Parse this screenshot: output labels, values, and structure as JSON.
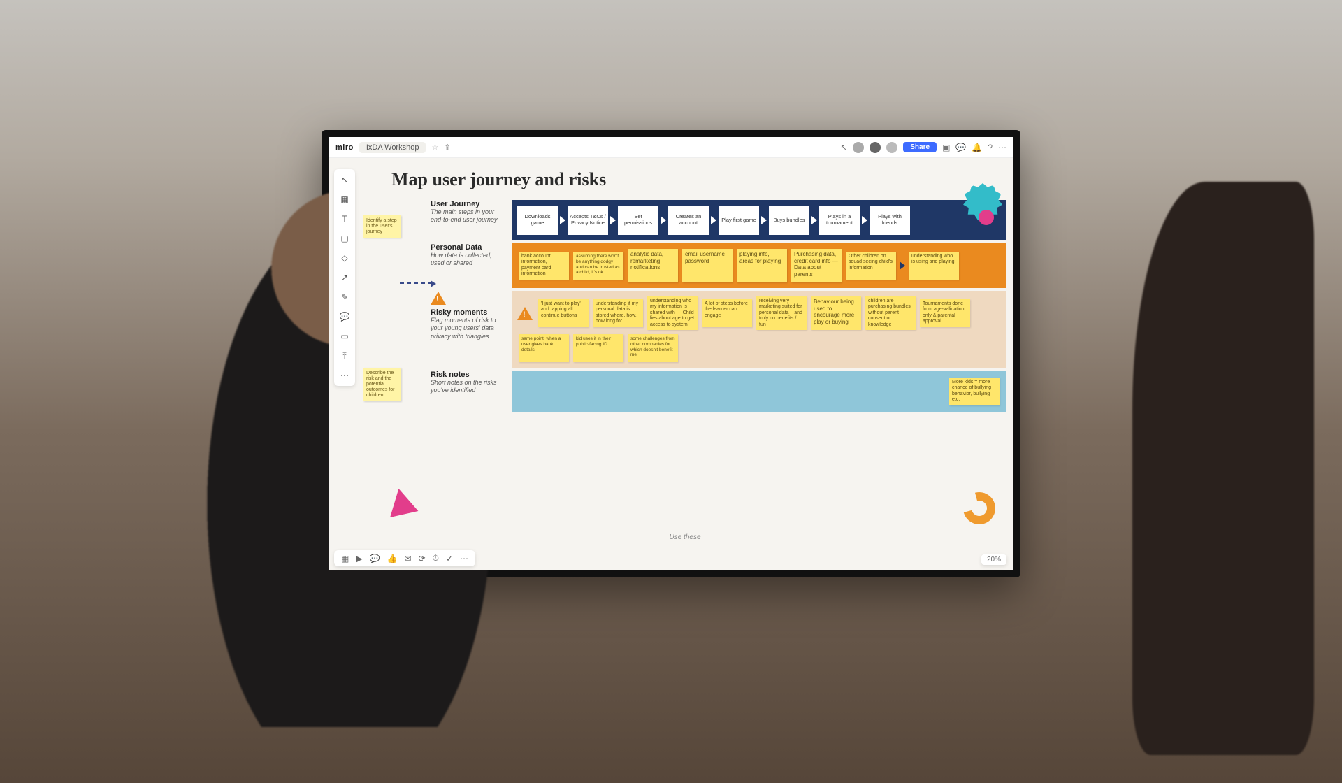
{
  "app": {
    "logo": "miro",
    "board_name": "IxDA Workshop"
  },
  "topbar": {
    "share_label": "Share",
    "zoom": "20%"
  },
  "side_notes": {
    "identify": "Identify a step in the user's journey",
    "describe": "Describe the risk and the potential outcomes for children"
  },
  "board_title": "Map user journey and risks",
  "rows": {
    "journey": {
      "title": "User Journey",
      "subtitle": "The main steps in your end-to-end user journey",
      "steps": [
        "Downloads game",
        "Accepts T&Cs / Privacy Notice",
        "Set permissions",
        "Creates an account",
        "Play first game",
        "Buys bundles",
        "Plays in a tournament",
        "Plays with friends"
      ]
    },
    "personal": {
      "title": "Personal Data",
      "subtitle": "How data is collected, used or shared",
      "stickies": [
        "bank account information, payment card information",
        "assuming there won't be anything dodgy and can be trusted as a child, it's ok",
        "analytic data, remarketing notifications",
        "email username password",
        "playing info, areas for playing",
        "Purchasing data, credit card info — Data about parents",
        "Other children on squad seeing child's information",
        "understanding who is using and playing"
      ]
    },
    "risky": {
      "title": "Risky moments",
      "subtitle": "Flag moments of risk to your young users' data privacy with triangles",
      "stickies": [
        "'I just want to play' and tapping all continue buttons",
        "understanding if my personal data is stored where, how, how long for",
        "understanding who my information is shared with — Child lies about age to get access to system",
        "A lot of steps before the learner can engage",
        "receiving very marketing suited for personal data – and truly no benefits / fun",
        "Behaviour being used to encourage more play or buying",
        "children are purchasing bundles without parent consent or knowledge",
        "Tournaments done from age-validation only & parental approval",
        "same point, when a user gives bank details",
        "kid uses it in their public-facing ID",
        "some challenges from other companies for which doesn't benefit me"
      ]
    },
    "notes": {
      "title": "Risk notes",
      "subtitle": "Short notes on the risks you've identified",
      "stickies": [
        "More kids = more chance of bullying behavior, bullying etc."
      ]
    }
  },
  "footer_hint": "Use these",
  "tools": [
    "cursor",
    "template",
    "text",
    "sticky",
    "shape",
    "connector",
    "pen",
    "comment",
    "frame",
    "upload",
    "apps"
  ],
  "bottom_tools": [
    "frames",
    "present",
    "comments",
    "reactions",
    "chat",
    "activity",
    "timer",
    "voting",
    "more"
  ]
}
